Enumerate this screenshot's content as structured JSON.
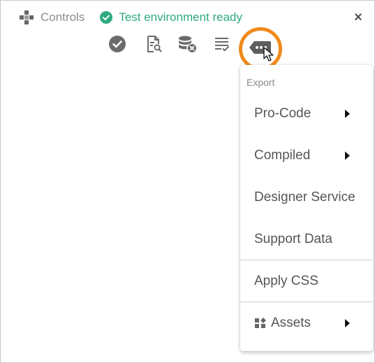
{
  "header": {
    "controls_label": "Controls",
    "status_text": "Test environment ready",
    "close_label": "×"
  },
  "toolbar": {
    "icons": [
      "check-circle-icon",
      "document-search-icon",
      "database-delete-icon",
      "checklist-icon",
      "more-options-icon"
    ]
  },
  "menu": {
    "section_label": "Export",
    "items": [
      {
        "label": "Pro-Code",
        "has_submenu": true
      },
      {
        "label": "Compiled",
        "has_submenu": true
      },
      {
        "label": "Designer Service",
        "has_submenu": false
      },
      {
        "label": "Support Data",
        "has_submenu": false
      },
      {
        "label": "Apply CSS",
        "has_submenu": false
      },
      {
        "label": "Assets",
        "has_submenu": true
      }
    ]
  },
  "colors": {
    "status_green": "#2eaa7e",
    "highlight_orange": "#f08a1a",
    "icon_gray": "#6b6b6b"
  }
}
